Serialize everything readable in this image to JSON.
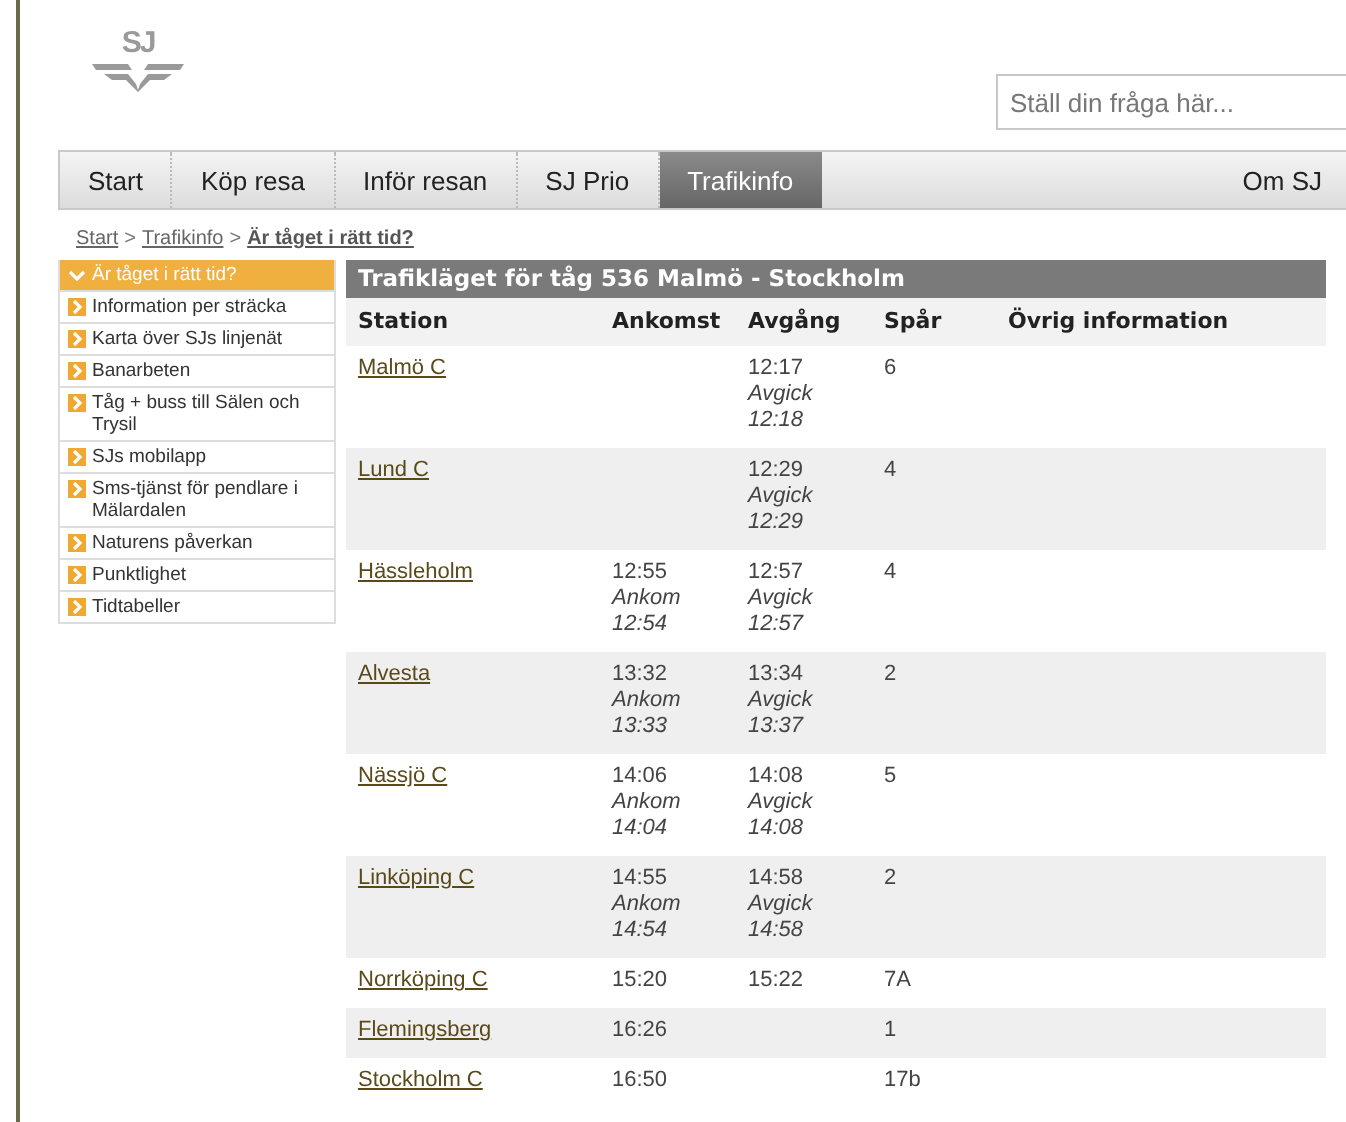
{
  "logo": {
    "text": "SJ"
  },
  "search": {
    "placeholder": "Ställ din fråga här..."
  },
  "nav": [
    {
      "label": "Start",
      "selected": false
    },
    {
      "label": "Köp resa",
      "selected": false
    },
    {
      "label": "Inför resan",
      "selected": false
    },
    {
      "label": "SJ Prio",
      "selected": false
    },
    {
      "label": "Trafikinfo",
      "selected": true
    }
  ],
  "nav_right": "Om SJ",
  "breadcrumb_separator": ">",
  "breadcrumb": [
    {
      "label": "Start",
      "current": false
    },
    {
      "label": "Trafikinfo",
      "current": false
    },
    {
      "label": "Är tåget i rätt tid?",
      "current": true
    }
  ],
  "sidebar": [
    {
      "label": "Är tåget i rätt tid?",
      "selected": true
    },
    {
      "label": "Information per sträcka",
      "selected": false
    },
    {
      "label": "Karta över SJs linjenät",
      "selected": false
    },
    {
      "label": "Banarbeten",
      "selected": false
    },
    {
      "label": "Tåg + buss till Sälen och Trysil",
      "selected": false
    },
    {
      "label": "SJs mobilapp",
      "selected": false
    },
    {
      "label": "Sms-tjänst för pendlare i Mälardalen",
      "selected": false
    },
    {
      "label": "Naturens påverkan",
      "selected": false
    },
    {
      "label": "Punktlighet",
      "selected": false
    },
    {
      "label": "Tidtabeller",
      "selected": false
    }
  ],
  "table": {
    "title": "Trafikläget för tåg 536 Malmö - Stockholm",
    "columns": [
      "Station",
      "Ankomst",
      "Avgång",
      "Spår",
      "Övrig information"
    ],
    "rows": [
      {
        "station": "Malmö C",
        "departure": "12:17",
        "departure_note": "Avgick 12:18",
        "track": "6"
      },
      {
        "station": "Lund C",
        "departure": "12:29",
        "departure_note": "Avgick 12:29",
        "track": "4"
      },
      {
        "station": "Hässleholm",
        "arrival": "12:55",
        "arrival_note": "Ankom 12:54",
        "departure": "12:57",
        "departure_note": "Avgick 12:57",
        "track": "4"
      },
      {
        "station": "Alvesta",
        "arrival": "13:32",
        "arrival_note": "Ankom 13:33",
        "departure": "13:34",
        "departure_note": "Avgick 13:37",
        "track": "2"
      },
      {
        "station": "Nässjö C",
        "arrival": "14:06",
        "arrival_note": "Ankom 14:04",
        "departure": "14:08",
        "departure_note": "Avgick 14:08",
        "track": "5"
      },
      {
        "station": "Linköping C",
        "arrival": "14:55",
        "arrival_note": "Ankom 14:54",
        "departure": "14:58",
        "departure_note": "Avgick 14:58",
        "track": "2"
      },
      {
        "station": "Norrköping C",
        "arrival": "15:20",
        "departure": "15:22",
        "track": "7A"
      },
      {
        "station": "Flemingsberg",
        "arrival": "16:26",
        "track": "1"
      },
      {
        "station": "Stockholm C",
        "arrival": "16:50",
        "track": "17b"
      }
    ]
  }
}
